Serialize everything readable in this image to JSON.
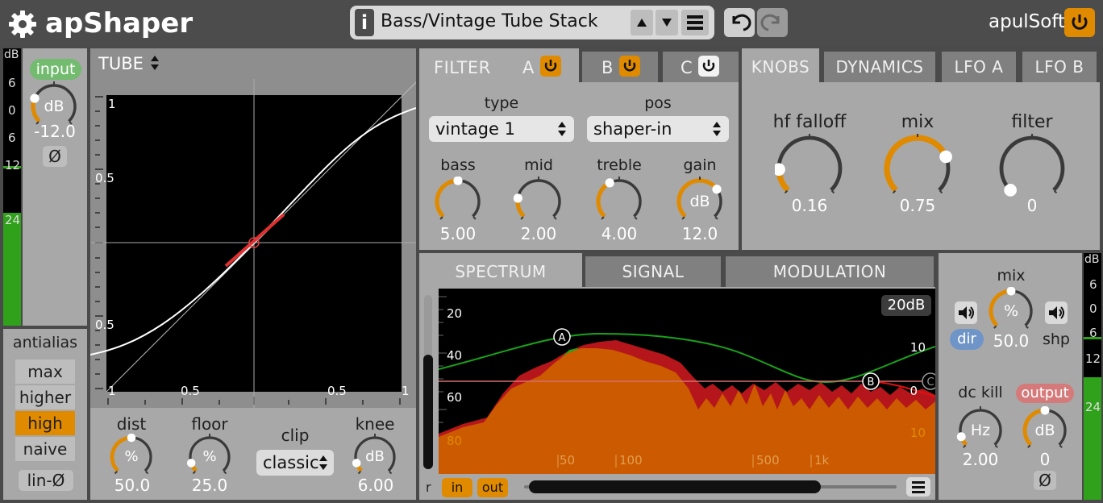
{
  "header": {
    "app_title": "apShaper",
    "preset_name": "Bass/Vintage Tube Stack",
    "brand": "apulSoft",
    "info_icon": "info-icon",
    "prev_icon": "triangle-up-icon",
    "next_icon": "triangle-down-icon",
    "menu_icon": "hamburger-icon",
    "undo_icon": "undo-icon",
    "redo_icon": "redo-icon"
  },
  "input": {
    "meter_db_label": "dB",
    "meter_ticks": [
      "6",
      "0",
      "6",
      "12",
      "24"
    ],
    "label": "input",
    "unit": "dB",
    "value": "-12.0",
    "value_fraction": 0.25,
    "phase_label": "Ø"
  },
  "antialias": {
    "title": "antialias",
    "options": [
      "max",
      "higher",
      "high",
      "naive"
    ],
    "selected": "high",
    "lin_phase": "lin-Ø"
  },
  "shaper": {
    "type_label": "TUBE",
    "axis_labels": [
      "1",
      "0.5",
      "0.5",
      "1",
      "0.5",
      "0.5",
      "1"
    ],
    "knobs": [
      {
        "label": "dist",
        "unit": "%",
        "value": "50.0",
        "fraction": 0.5
      },
      {
        "label": "floor",
        "unit": "%",
        "value": "25.0",
        "fraction": 0.1
      }
    ],
    "clip_label": "clip",
    "clip_value": "classic",
    "knee": {
      "label": "knee",
      "unit": "dB",
      "value": "6.00",
      "fraction": 0.1
    }
  },
  "filter": {
    "title": "FILTER",
    "tabs": [
      {
        "label": "A",
        "on": true
      },
      {
        "label": "B",
        "on": true
      },
      {
        "label": "C",
        "on": false
      }
    ],
    "type_label": "type",
    "type_value": "vintage 1",
    "pos_label": "pos",
    "pos_value": "shaper-in",
    "knobs": [
      {
        "label": "bass",
        "unit": "",
        "value": "5.00",
        "fraction": 0.5
      },
      {
        "label": "mid",
        "unit": "",
        "value": "2.00",
        "fraction": 0.2
      },
      {
        "label": "treble",
        "unit": "",
        "value": "4.00",
        "fraction": 0.4
      },
      {
        "label": "gain",
        "unit": "dB",
        "value": "12.0",
        "fraction": 0.7
      }
    ]
  },
  "knobs_panel": {
    "tabs": [
      "KNOBS",
      "DYNAMICS",
      "LFO A",
      "LFO B"
    ],
    "active_tab": "KNOBS",
    "knobs": [
      {
        "label": "hf falloff",
        "value": "0.16",
        "fraction": 0.16
      },
      {
        "label": "mix",
        "value": "0.75",
        "fraction": 0.75
      },
      {
        "label": "filter",
        "value": "0",
        "fraction": 0.0
      }
    ]
  },
  "spectrum": {
    "tabs": [
      "SPECTRUM",
      "SIGNAL",
      "MODULATION"
    ],
    "active_tab": "SPECTRUM",
    "range_badge": "20dB",
    "left_scale": [
      "20",
      "40",
      "60",
      "80"
    ],
    "right_scale": [
      "10",
      "0",
      "10"
    ],
    "freq_labels": [
      "50",
      "100",
      "500",
      "1k"
    ],
    "node_labels": [
      "A",
      "B",
      "C"
    ],
    "r_label": "r",
    "in_label": "in",
    "out_label": "out",
    "menu_icon": "hamburger-icon"
  },
  "output": {
    "mix_label": "mix",
    "mix_unit": "%",
    "mix_value": "50.0",
    "mix_fraction": 0.5,
    "dir_label": "dir",
    "shp_label": "shp",
    "dc_kill_label": "dc kill",
    "dc_kill_unit": "Hz",
    "dc_kill_value": "2.00",
    "dc_kill_fraction": 0.1,
    "output_label": "output",
    "output_unit": "dB",
    "output_value": "0",
    "output_fraction": 0.5,
    "phase_label": "Ø",
    "meter_db_label": "dB",
    "meter_ticks": [
      "6",
      "0",
      "6",
      "12",
      "24"
    ]
  },
  "colors": {
    "accent": "#e08a00",
    "meter_green": "#2fa11a",
    "curve_green": "#1aa31a",
    "spectrum_red": "#b5161b"
  }
}
